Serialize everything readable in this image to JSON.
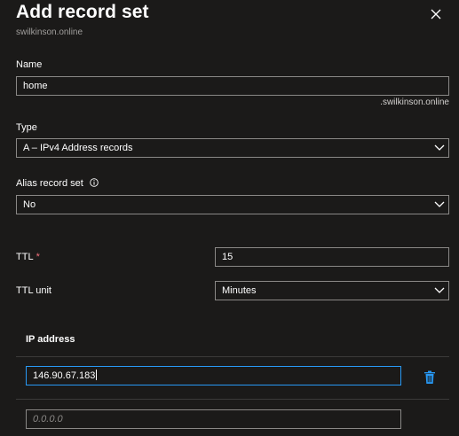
{
  "panel": {
    "title": "Add record set",
    "subtitle": "swilkinson.online"
  },
  "name_field": {
    "label": "Name",
    "value": "home",
    "suffix": ".swilkinson.online"
  },
  "type_field": {
    "label": "Type",
    "selected": "A – IPv4 Address records"
  },
  "alias_field": {
    "label": "Alias record set",
    "selected": "No"
  },
  "ttl_field": {
    "label": "TTL",
    "required_marker": "*",
    "value": "15"
  },
  "ttl_unit_field": {
    "label": "TTL unit",
    "selected": "Minutes"
  },
  "ip_section": {
    "header": "IP address",
    "entries": [
      "146.90.67.183"
    ],
    "new_entry_placeholder": "0.0.0.0"
  },
  "icons": {
    "close": "close-icon",
    "chevron": "chevron-down-icon",
    "info": "info-icon",
    "delete": "trash-icon"
  },
  "colors": {
    "background": "#1b1a19",
    "border": "#8a8886",
    "focus": "#2899f5",
    "required": "#f1707b",
    "delete_icon": "#2899f5"
  }
}
